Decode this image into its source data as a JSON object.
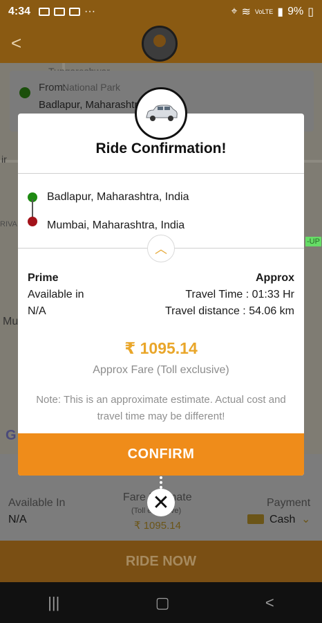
{
  "status_bar": {
    "time": "4:34",
    "more": "···",
    "battery": "9%",
    "network": "VoLTE"
  },
  "map": {
    "place_label": "Tungareshwar",
    "place_label_2": "National Park",
    "from_label": "From:",
    "from_address": "Badlapur, Maharashtra, India",
    "side_label_left": "ir",
    "side_label_left2": "RIVA",
    "side_label_right": "-UP",
    "side_label_mu": "Mu",
    "google_label": "G"
  },
  "dialog": {
    "title": "Ride Confirmation!",
    "pickup": "Badlapur, Maharashtra, India",
    "dropoff": "Mumbai, Maharashtra, India",
    "left_header": "Prime",
    "available_in_label": "Available in",
    "available_in_value": "N/A",
    "right_header": "Approx",
    "travel_time": "Travel Time : 01:33 Hr",
    "travel_distance": "Travel distance : 54.06 km",
    "fare": "₹ 1095.14",
    "fare_caption": "Approx Fare (Toll exclusive)",
    "note": "Note: This is an approximate estimate. Actual cost and travel time may be different!",
    "confirm_label": "CONFIRM",
    "close_symbol": "✕"
  },
  "bottom_panel": {
    "available_in_label": "Available In",
    "available_in_value": "N/A",
    "fare_label": "Fare Estimate",
    "fare_sub": "(Toll exclusive)",
    "fare_value": "₹ 1095.14",
    "payment_label": "Payment",
    "payment_value": "Cash"
  },
  "ride_now_label": "RIDE NOW",
  "colors": {
    "accent": "#ef8c1a",
    "fare": "#e9a62a",
    "pickup_dot": "#1e8a12",
    "drop_dot": "#a3121a"
  }
}
